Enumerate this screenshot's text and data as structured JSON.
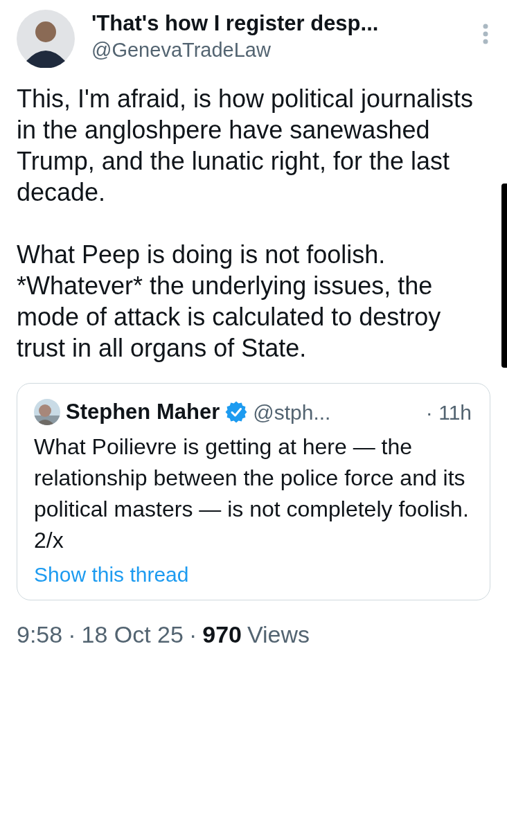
{
  "author": {
    "display_name": "'That's how I register desp...",
    "handle": "@GenevaTradeLaw"
  },
  "body": [
    "This, I'm afraid, is how political journalists in the angloshpere have sanewashed Trump, and the lunatic right, for the last decade.",
    "What Peep is doing is not foolish. *Whatever* the underlying issues, the mode of attack is calculated to destroy trust in all organs of State."
  ],
  "quote": {
    "name": "Stephen Maher",
    "verified": true,
    "handle": "@stph...",
    "time": "· 11h",
    "text": "What Poilievre is getting at here — the relationship between the police force and its political masters — is not completely foolish. 2/x",
    "link": "Show this thread"
  },
  "footer": {
    "time": "9:58",
    "date": "18 Oct 25",
    "views_count": "970",
    "views_label": "Views",
    "separators": [
      "·",
      "·"
    ]
  }
}
